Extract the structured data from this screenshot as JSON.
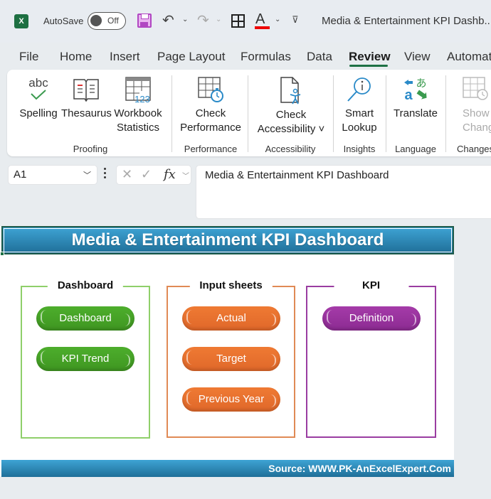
{
  "titlebar": {
    "app_icon": "excel-logo-icon",
    "app_icon_letter": "X",
    "autosave_label": "AutoSave",
    "autosave_state": "Off",
    "doc_title": "Media & Entertainment KPI Dashb...",
    "icons": [
      "save-icon",
      "undo-icon",
      "redo-icon",
      "borders-icon",
      "font-color-icon",
      "customize-toolbar-icon"
    ]
  },
  "menu": {
    "tabs": [
      "File",
      "Home",
      "Insert",
      "Page Layout",
      "Formulas",
      "Data",
      "Review",
      "View",
      "Automat"
    ],
    "active": "Review"
  },
  "ribbon": {
    "groups": [
      {
        "label": "Proofing",
        "buttons": [
          {
            "label": "Spelling",
            "icon": "spelling-icon"
          },
          {
            "label": "Thesaurus",
            "icon": "thesaurus-icon"
          },
          {
            "label": "Workbook",
            "label2": "Statistics",
            "icon": "workbook-statistics-icon"
          }
        ]
      },
      {
        "label": "Performance",
        "buttons": [
          {
            "label": "Check",
            "label2": "Performance",
            "icon": "check-performance-icon"
          }
        ]
      },
      {
        "label": "Accessibility",
        "buttons": [
          {
            "label": "Check",
            "label2": "Accessibility ˅",
            "icon": "check-accessibility-icon"
          }
        ]
      },
      {
        "label": "Insights",
        "buttons": [
          {
            "label": "Smart",
            "label2": "Lookup",
            "icon": "smart-lookup-icon"
          }
        ]
      },
      {
        "label": "Language",
        "buttons": [
          {
            "label": "Translate",
            "icon": "translate-icon"
          }
        ]
      },
      {
        "label": "Changes",
        "buttons": [
          {
            "label": "Show",
            "label2": "Changes",
            "icon": "show-changes-icon",
            "disabled": true
          }
        ]
      }
    ]
  },
  "formula_bar": {
    "name_box": "A1",
    "fx": "fx",
    "formula": "Media & Entertainment KPI Dashboard"
  },
  "sheet": {
    "header": "Media & Entertainment KPI Dashboard",
    "groups": [
      {
        "title": "Dashboard",
        "color": "#8fcf6a",
        "buttons": [
          "Dashboard",
          "KPI Trend"
        ]
      },
      {
        "title": "Input sheets",
        "color": "#e08a55",
        "buttons": [
          "Actual",
          "Target",
          "Previous Year"
        ]
      },
      {
        "title": "KPI",
        "color": "#9a3da1",
        "buttons": [
          "Definition"
        ]
      }
    ],
    "source": "Source: WWW.PK-AnExcelExpert.Com"
  },
  "colors": {
    "accent_green": "#1e7145",
    "header_blue": "#2b88b8",
    "pill_green": "#46a226",
    "pill_orange": "#e8712e",
    "pill_purple": "#9a339e"
  }
}
